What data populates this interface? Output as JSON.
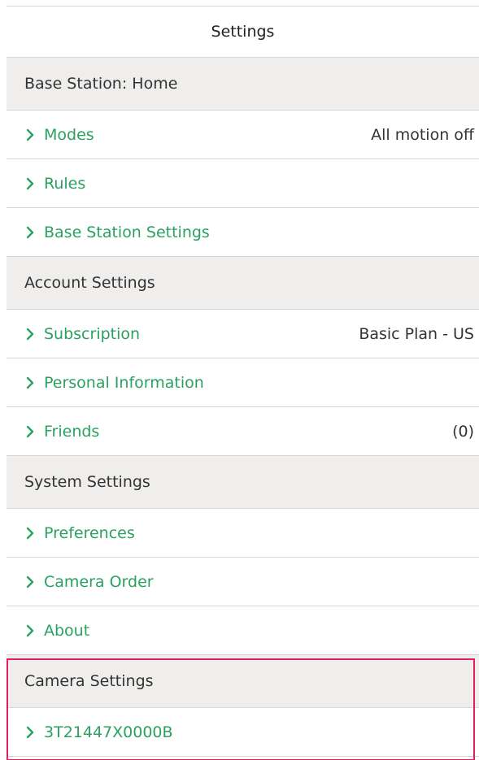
{
  "header": {
    "title": "Settings"
  },
  "sections": [
    {
      "title": "Base Station: Home",
      "items": [
        {
          "label": "Modes",
          "value": "All motion off"
        },
        {
          "label": "Rules",
          "value": ""
        },
        {
          "label": "Base Station Settings",
          "value": ""
        }
      ]
    },
    {
      "title": "Account Settings",
      "items": [
        {
          "label": "Subscription",
          "value": "Basic Plan - US"
        },
        {
          "label": "Personal Information",
          "value": ""
        },
        {
          "label": "Friends",
          "value": "(0)"
        }
      ]
    },
    {
      "title": "System Settings",
      "items": [
        {
          "label": "Preferences",
          "value": ""
        },
        {
          "label": "Camera Order",
          "value": ""
        },
        {
          "label": "About",
          "value": ""
        }
      ]
    },
    {
      "title": "Camera Settings",
      "items": [
        {
          "label": "3T21447X0000B",
          "value": ""
        }
      ]
    }
  ],
  "icons": {
    "row_chevron": "chevron-right-icon"
  },
  "colors": {
    "accent_green": "#2aa15f",
    "section_bg": "#efeeec",
    "divider": "#d6d6d6",
    "highlight": "#e01f5c"
  }
}
